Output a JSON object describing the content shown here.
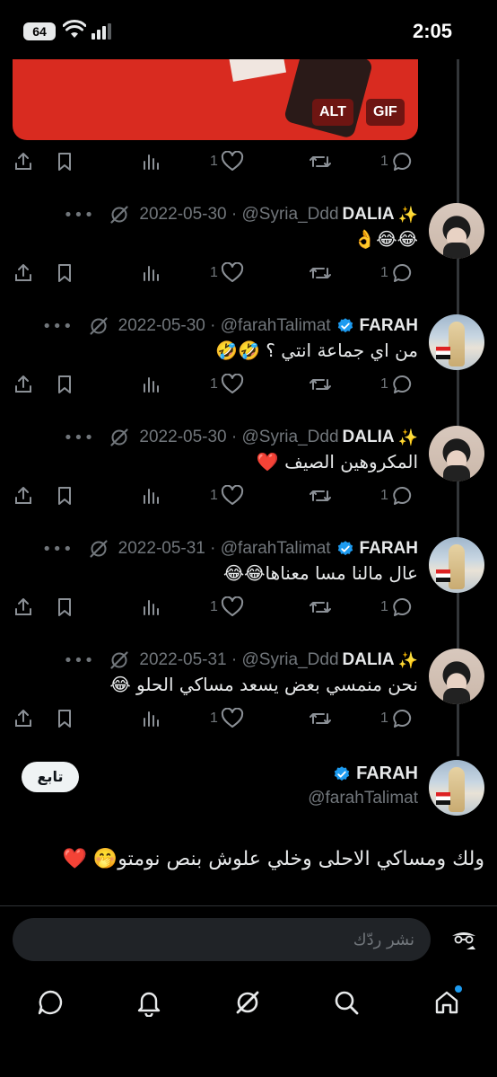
{
  "status_bar": {
    "battery": "64",
    "time": "2:05"
  },
  "media": {
    "alt_label": "ALT",
    "gif_label": "GIF"
  },
  "action_counts": {
    "likes": "1",
    "replies": "1"
  },
  "replies": [
    {
      "name": "DALIA",
      "sparkle": "✨",
      "handle": "@Syria_Ddd",
      "date": "2022-05-30",
      "text": "😂😂👌",
      "verified": false,
      "avatar": "dalia"
    },
    {
      "name": "FARAH",
      "handle": "@farahTalimat",
      "date": "2022-05-30",
      "text": "من اي جماعة انتي ؟ 🤣🤣",
      "verified": true,
      "avatar": "farah"
    },
    {
      "name": "DALIA",
      "sparkle": "✨",
      "handle": "@Syria_Ddd",
      "date": "2022-05-30",
      "text": "المكروهين الصيف ❤️",
      "verified": false,
      "avatar": "dalia"
    },
    {
      "name": "FARAH",
      "handle": "@farahTalimat",
      "date": "2022-05-31",
      "text": "عال مالنا مسا معناها😂😂",
      "verified": true,
      "avatar": "farah"
    },
    {
      "name": "DALIA",
      "sparkle": "✨",
      "handle": "@Syria_Ddd",
      "date": "2022-05-31",
      "text": "نحن منمسي بعض يسعد مساكي الحلو 😂",
      "verified": false,
      "avatar": "dalia"
    }
  ],
  "main_post": {
    "name": "FARAH",
    "handle": "@farahTalimat",
    "follow_label": "تابع",
    "text": "ولك ومساكي الاحلى وخلي علوش بنص نومتو🤭 ❤️"
  },
  "reply_box": {
    "placeholder": "نشر ردّك"
  },
  "nav": [
    "home-icon",
    "search-icon",
    "grok-icon",
    "notifications-icon",
    "messages-icon"
  ],
  "colors": {
    "background": "#000000",
    "text": "#e7e9ea",
    "muted": "#71767b",
    "accent": "#1d9bf0",
    "like_red": "#f91880"
  }
}
